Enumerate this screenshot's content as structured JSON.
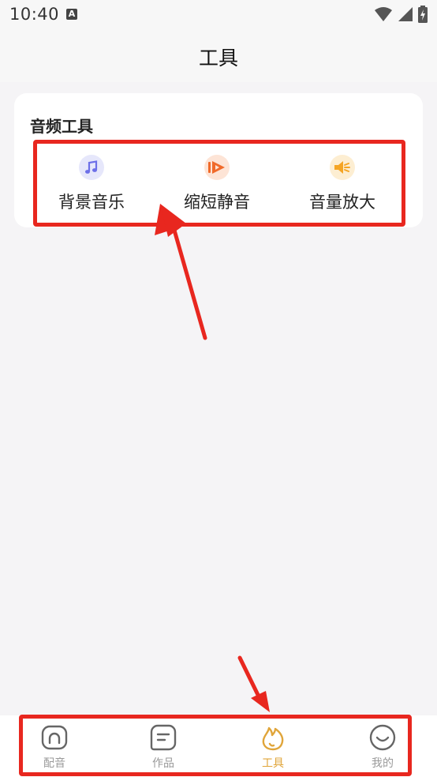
{
  "status": {
    "time": "10:40",
    "notification_letter": "A"
  },
  "header": {
    "title": "工具"
  },
  "audio_tools": {
    "title": "音频工具",
    "items": [
      {
        "label": "背景音乐",
        "icon": "music-note-icon",
        "color": "#6c6fe8"
      },
      {
        "label": "缩短静音",
        "icon": "fast-forward-icon",
        "color": "#f06a2a"
      },
      {
        "label": "音量放大",
        "icon": "speaker-icon",
        "color": "#f5a524"
      }
    ]
  },
  "bottom_nav": {
    "items": [
      {
        "label": "配音",
        "icon": "home-icon",
        "active": false
      },
      {
        "label": "作品",
        "icon": "works-icon",
        "active": false
      },
      {
        "label": "工具",
        "icon": "flame-icon",
        "active": true
      },
      {
        "label": "我的",
        "icon": "smile-icon",
        "active": false
      }
    ]
  },
  "colors": {
    "accent": "#e0a53a",
    "annotation": "#e8271f"
  }
}
